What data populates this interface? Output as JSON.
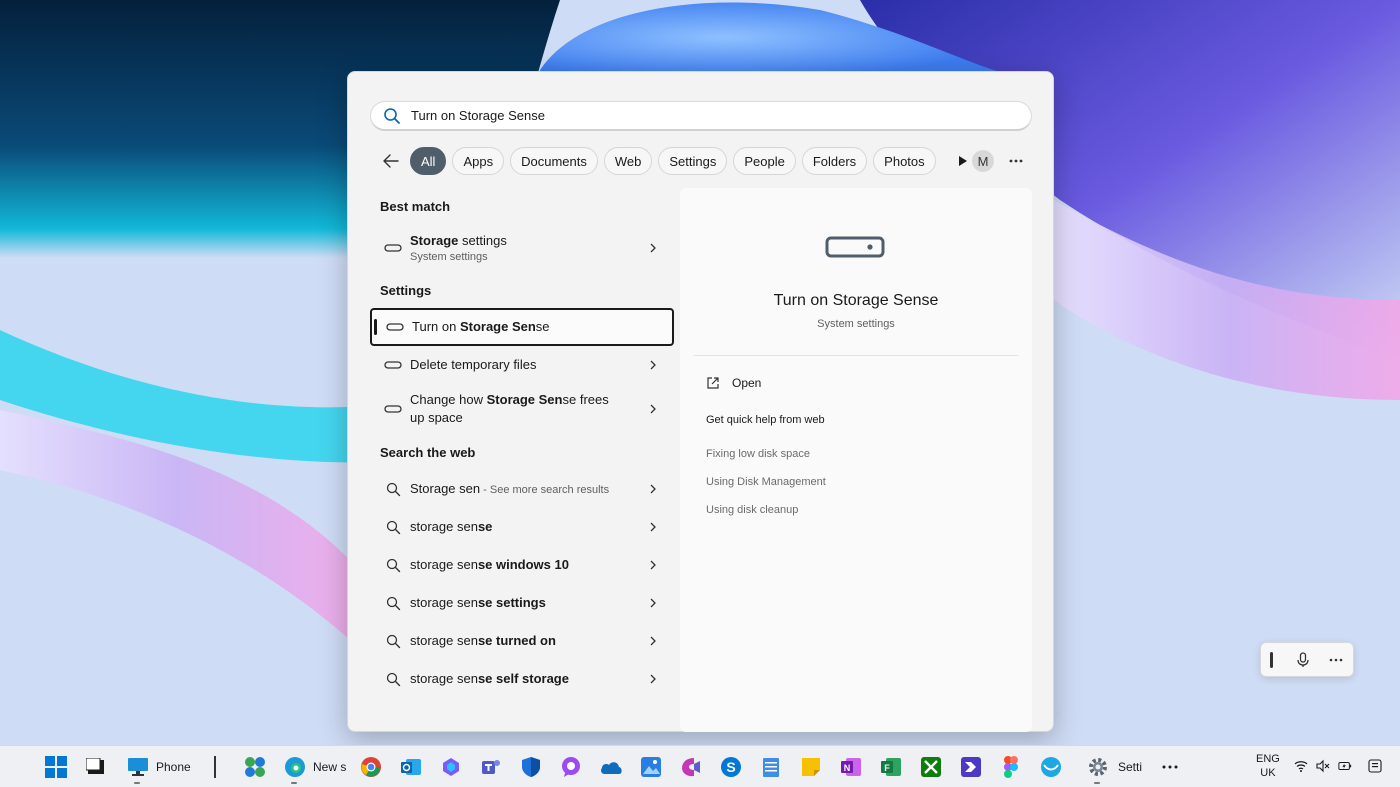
{
  "search": {
    "query": "Turn on Storage Sense"
  },
  "filters": {
    "items": [
      "All",
      "Apps",
      "Documents",
      "Web",
      "Settings",
      "People",
      "Folders",
      "Photos"
    ],
    "avatar_letter": "M"
  },
  "results": {
    "best_match_title": "Best match",
    "best_match": {
      "pre": "",
      "bold": "Storage",
      "post": " settings",
      "subtitle": "System settings"
    },
    "settings_title": "Settings",
    "settings": [
      {
        "pre": "Turn on ",
        "bold": "Storage Sen",
        "post": "se"
      },
      {
        "pre": "Delete temporary files",
        "bold": "",
        "post": ""
      },
      {
        "pre": "Change how ",
        "bold": "Storage Sen",
        "post": "se frees up space"
      }
    ],
    "web_title": "Search the web",
    "web_first": {
      "text": "Storage sen",
      "hint": " - See more search results"
    },
    "web": [
      {
        "pre": "storage sen",
        "bold": "se",
        "post": ""
      },
      {
        "pre": "storage sen",
        "bold": "se windows 10",
        "post": ""
      },
      {
        "pre": "storage sen",
        "bold": "se settings",
        "post": ""
      },
      {
        "pre": "storage sen",
        "bold": "se turned on",
        "post": ""
      },
      {
        "pre": "storage sen",
        "bold": "se self storage",
        "post": ""
      }
    ]
  },
  "preview": {
    "title": "Turn on Storage Sense",
    "subtitle": "System settings",
    "open_label": "Open",
    "help_title": "Get quick help from web",
    "links": [
      "Fixing low disk space",
      "Using Disk Management",
      "Using disk cleanup"
    ]
  },
  "taskbar": {
    "phone_label": "Phone",
    "news_label": "New s",
    "settings_label": "Setti",
    "lang_1": "ENG",
    "lang_2": "UK"
  },
  "colors": {
    "active_chip": "#505e6b",
    "accent_blue": "#0067c0"
  }
}
